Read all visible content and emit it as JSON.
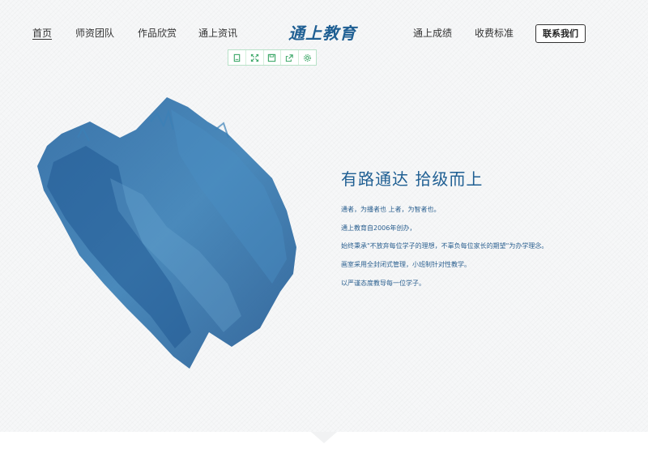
{
  "nav": {
    "home": "首页",
    "teachers": "师资团队",
    "works": "作品欣赏",
    "news": "通上资讯",
    "results": "通上成绩",
    "fees": "收费标准",
    "contact": "联系我们"
  },
  "logo": {
    "text": "通上教育"
  },
  "toolbar": {
    "icons": [
      "note-icon",
      "expand-icon",
      "save-icon",
      "share-icon",
      "settings-icon"
    ]
  },
  "hero": {
    "headline": "有路通达 拾级而上",
    "paragraphs": [
      "通者，为播者也 上者，为智者也。",
      "通上教育自2006年创办，",
      "始终秉承\"不放弃每位学子的理想，不辜负每位家长的期望\"为办学理念。",
      "画室采用全封闭式管理，小班制针对性教学。",
      "以严谨态度教导每一位学子。"
    ]
  },
  "colors": {
    "accent": "#1f5f93",
    "ink": "#2f6ea5",
    "toolbar_green": "#3aa666"
  }
}
